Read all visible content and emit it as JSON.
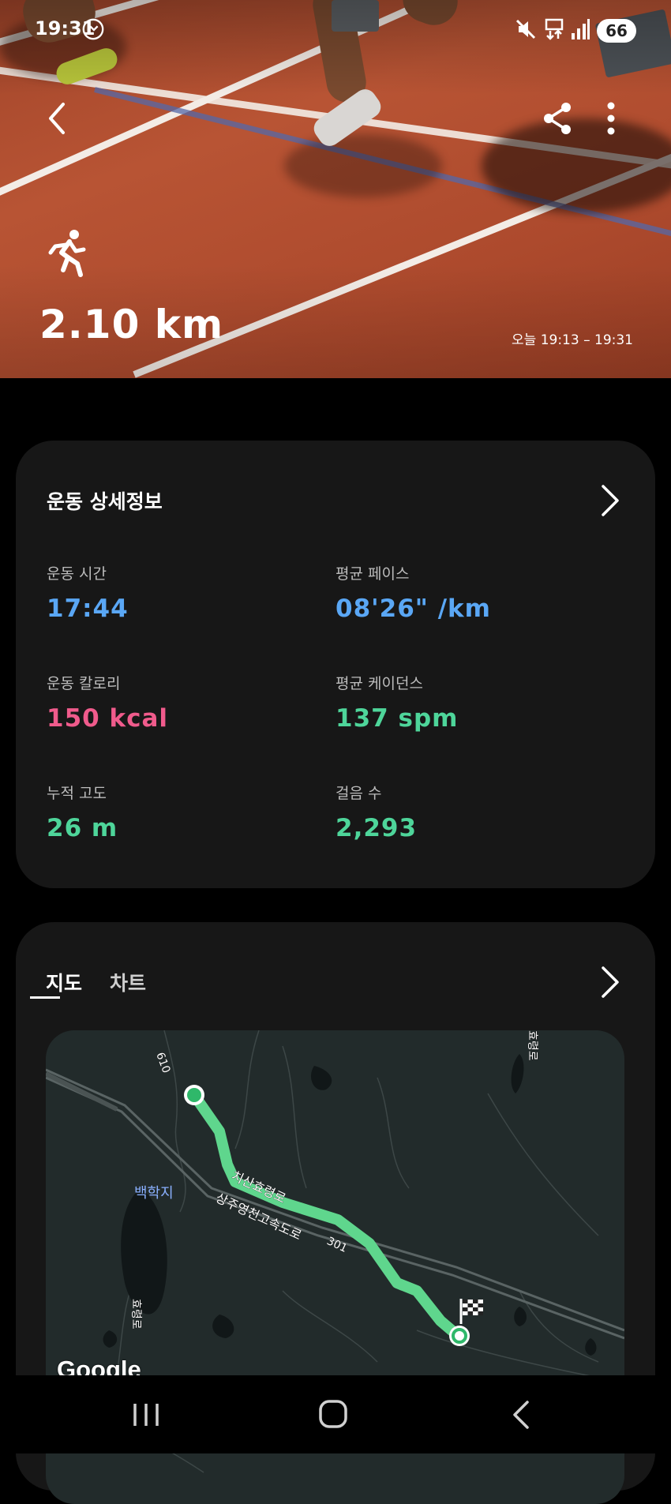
{
  "status_bar": {
    "time": "19:31",
    "battery": "66",
    "icons": [
      "chrome-sync-icon",
      "mute-icon",
      "network-data-icon",
      "signal-icon",
      "battery-icon"
    ]
  },
  "hero": {
    "icons": [
      "back-arrow-icon",
      "share-icon",
      "more-vert-icon",
      "running-person-icon"
    ],
    "distance": "2.10 km",
    "time_range": "오늘 19:13 – 19:31"
  },
  "details": {
    "title": "운동 상세정보",
    "stats": [
      {
        "label": "운동 시간",
        "value": "17:44",
        "color": "#5aa7f5"
      },
      {
        "label": "평균 페이스",
        "value": "08'26\" /km",
        "color": "#5aa7f5"
      },
      {
        "label": "운동 칼로리",
        "value": "150 kcal",
        "color": "#f05b8c"
      },
      {
        "label": "평균 케이던스",
        "value": "137 spm",
        "color": "#4ed59a"
      },
      {
        "label": "누적 고도",
        "value": "26 m",
        "color": "#4ed59a"
      },
      {
        "label": "걸음 수",
        "value": "2,293",
        "color": "#4ed59a"
      }
    ]
  },
  "map_card": {
    "tabs": [
      {
        "label": "지도",
        "active": true
      },
      {
        "label": "차트",
        "active": false
      }
    ],
    "map_labels": {
      "road_610": "610",
      "road_301": "301",
      "road_ribbon": "치산효령로",
      "expressway": "상주영천고속도로",
      "lake": "백학지",
      "vertical_top": "효령로",
      "vertical_left": "효령로"
    },
    "google_logo": "Google",
    "route_color": "#5fd68d"
  },
  "nav": {
    "icons": [
      "recent-apps-icon",
      "home-icon",
      "back-icon"
    ]
  }
}
